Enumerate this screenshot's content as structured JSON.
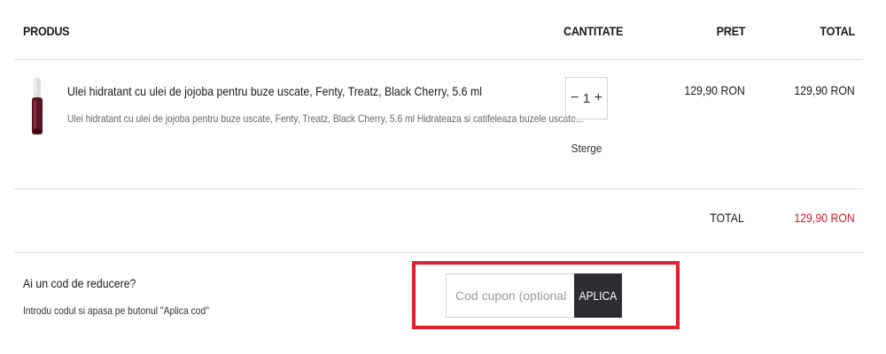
{
  "table": {
    "headers": {
      "product": "PRODUS",
      "quantity": "CANTITATE",
      "price": "PRET",
      "total": "TOTAL"
    }
  },
  "item": {
    "name": "Ulei hidratant cu ulei de jojoba pentru buze uscate, Fenty, Treatz, Black Cherry, 5.6 ml",
    "description": "Ulei hidratant cu ulei de jojoba pentru buze uscate, Fenty, Treatz, Black Cherry, 5.6 ml Hidrateaza si catifeleaza buzele uscate...",
    "quantity": "1",
    "minus": "−",
    "plus": "+",
    "remove_label": "Sterge",
    "price": "129,90 RON",
    "line_total": "129,90 RON",
    "thumb_icon": "lip-oil-bottle"
  },
  "summary": {
    "label": "TOTAL",
    "value": "129,90 RON",
    "value_color": "#c41e2a"
  },
  "coupon": {
    "question": "Ai un cod de reducere?",
    "hint": "Introdu codul si apasa pe butonul \"Aplica cod\"",
    "placeholder": "Cod cupon (optional)",
    "value": "",
    "button_label": "APLICA",
    "highlight_color": "#e0202c"
  }
}
